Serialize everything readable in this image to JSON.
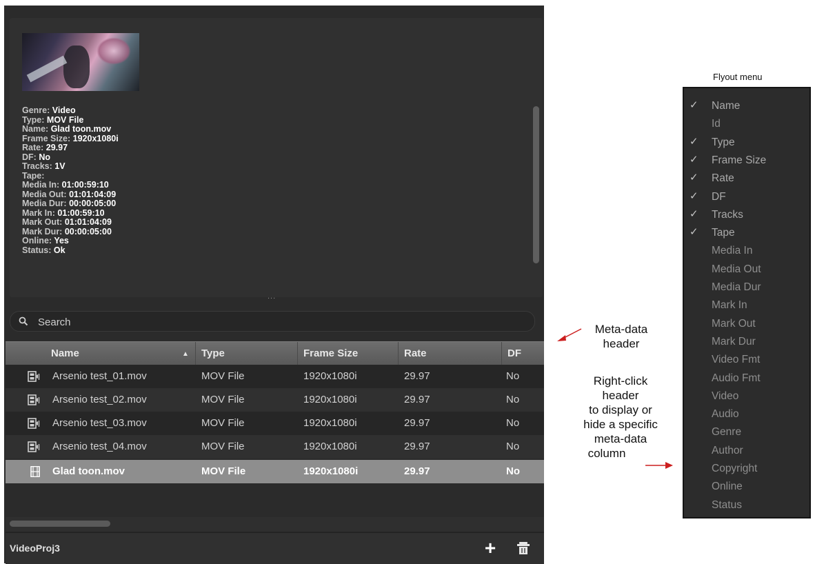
{
  "metadata_panel": {
    "fields": [
      {
        "key": "Genre:",
        "value": "Video"
      },
      {
        "key": "Type:",
        "value": "MOV File"
      },
      {
        "key": "Name:",
        "value": "Glad toon.mov"
      },
      {
        "key": "Frame Size:",
        "value": "1920x1080i"
      },
      {
        "key": "Rate:",
        "value": "29.97"
      },
      {
        "key": "DF:",
        "value": "No"
      },
      {
        "key": "Tracks:",
        "value": "1V"
      },
      {
        "key": "Tape:",
        "value": ""
      },
      {
        "key": "Media In:",
        "value": "01:00:59:10"
      },
      {
        "key": "Media Out:",
        "value": "01:01:04:09"
      },
      {
        "key": "Media Dur:",
        "value": "00:00:05:00"
      },
      {
        "key": "Mark In:",
        "value": "01:00:59:10"
      },
      {
        "key": "Mark Out:",
        "value": "01:01:04:09"
      },
      {
        "key": "Mark Dur:",
        "value": "00:00:05:00"
      },
      {
        "key": "Online:",
        "value": "Yes"
      },
      {
        "key": "Status:",
        "value": "Ok"
      }
    ],
    "splitter": "..."
  },
  "search": {
    "placeholder": "Search",
    "icon": "search-icon"
  },
  "table": {
    "headers": [
      "Name",
      "Type",
      "Frame Size",
      "Rate",
      "DF"
    ],
    "sort_indicator": "▲",
    "rows": [
      {
        "name": "Arsenio test_01.mov",
        "type": "MOV File",
        "frame_size": "1920x1080i",
        "rate": "29.97",
        "df": "No",
        "icon": "clip-icon"
      },
      {
        "name": "Arsenio test_02.mov",
        "type": "MOV File",
        "frame_size": "1920x1080i",
        "rate": "29.97",
        "df": "No",
        "icon": "clip-icon"
      },
      {
        "name": "Arsenio test_03.mov",
        "type": "MOV File",
        "frame_size": "1920x1080i",
        "rate": "29.97",
        "df": "No",
        "icon": "clip-icon"
      },
      {
        "name": "Arsenio test_04.mov",
        "type": "MOV File",
        "frame_size": "1920x1080i",
        "rate": "29.97",
        "df": "No",
        "icon": "clip-icon"
      },
      {
        "name": "Glad toon.mov",
        "type": "MOV File",
        "frame_size": "1920x1080i",
        "rate": "29.97",
        "df": "No",
        "icon": "film-icon",
        "selected": true
      }
    ]
  },
  "footer": {
    "project_name": "VideoProj3",
    "add_label": "+",
    "delete_icon": "trash-icon"
  },
  "annotations": {
    "metadata_header_line1": "Meta-data",
    "metadata_header_line2": "header",
    "right_click_lines": [
      "Right-click",
      "header",
      "to display or",
      "hide a specific",
      "meta-data",
      "column"
    ]
  },
  "flyout": {
    "title": "Flyout menu",
    "items": [
      {
        "label": "Name",
        "checked": true
      },
      {
        "label": "Id",
        "checked": false
      },
      {
        "label": "Type",
        "checked": true
      },
      {
        "label": "Frame Size",
        "checked": true
      },
      {
        "label": "Rate",
        "checked": true
      },
      {
        "label": "DF",
        "checked": true
      },
      {
        "label": "Tracks",
        "checked": true
      },
      {
        "label": "Tape",
        "checked": true
      },
      {
        "label": "Media In",
        "checked": false
      },
      {
        "label": "Media Out",
        "checked": false
      },
      {
        "label": "Media Dur",
        "checked": false
      },
      {
        "label": "Mark In",
        "checked": false
      },
      {
        "label": "Mark Out",
        "checked": false
      },
      {
        "label": "Mark Dur",
        "checked": false
      },
      {
        "label": "Video Fmt",
        "checked": false
      },
      {
        "label": "Audio Fmt",
        "checked": false
      },
      {
        "label": "Video",
        "checked": false
      },
      {
        "label": "Audio",
        "checked": false
      },
      {
        "label": "Genre",
        "checked": false
      },
      {
        "label": "Author",
        "checked": false
      },
      {
        "label": "Copyright",
        "checked": false
      },
      {
        "label": "Online",
        "checked": false
      },
      {
        "label": "Status",
        "checked": false
      }
    ],
    "check_glyph": "✓"
  },
  "colors": {
    "annotation_arrow": "#cc1f1f",
    "selected_row": "#8e8e8e",
    "header": "#626262"
  }
}
